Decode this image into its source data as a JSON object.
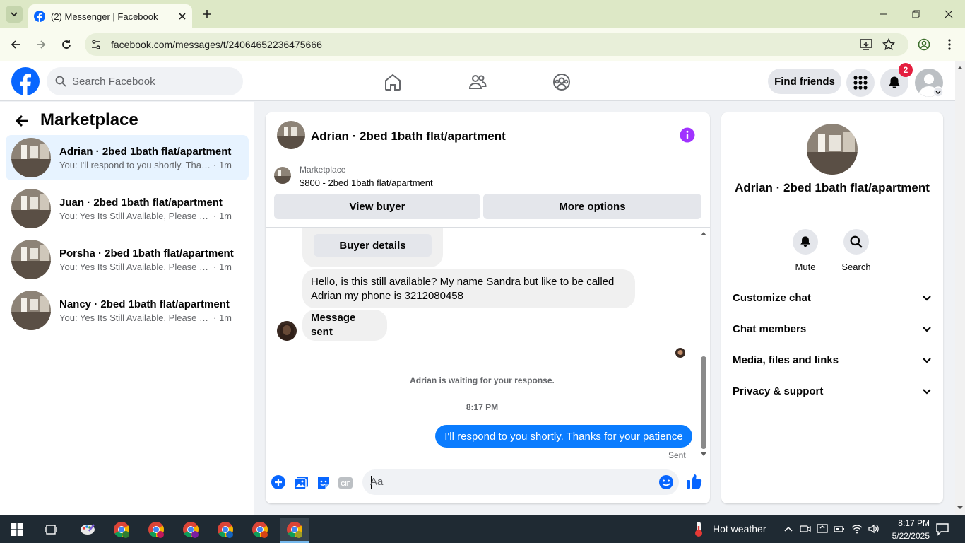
{
  "browser": {
    "tab_title": "(2) Messenger | Facebook",
    "url": "facebook.com/messages/t/24064652236475666"
  },
  "header": {
    "search_placeholder": "Search Facebook",
    "find_friends_label": "Find friends",
    "notification_count": "2"
  },
  "left_panel": {
    "title": "Marketplace",
    "conversations": [
      {
        "name": "Adrian · 2bed 1bath flat/apartment",
        "preview": "You: I'll respond to you shortly. Than...",
        "time": "· 1m",
        "active": true
      },
      {
        "name": "Juan · 2bed 1bath flat/apartment",
        "preview": "You: Yes Its Still Available, Please Sen...",
        "time": "· 1m",
        "active": false
      },
      {
        "name": "Porsha · 2bed 1bath flat/apartment",
        "preview": "You: Yes Its Still Available, Please Sen...",
        "time": "· 1m",
        "active": false
      },
      {
        "name": "Nancy · 2bed 1bath flat/apartment",
        "preview": "You: Yes Its Still Available, Please Sen...",
        "time": "· 1m",
        "active": false
      }
    ]
  },
  "chat": {
    "title": "Adrian · 2bed 1bath flat/apartment",
    "marketplace_label": "Marketplace",
    "listing": "$800 - 2bed 1bath flat/apartment",
    "view_buyer_label": "View buyer",
    "more_options_label": "More options",
    "buyer_details_label": "Buyer details",
    "incoming_message": "Hello, is this still available? My name Sandra but like to be called Adrian my phone is 3212080458",
    "message_sent": "Message sent",
    "system_message": "Adrian is waiting for your response.",
    "timestamp": "8:17 PM",
    "outgoing_message": "I'll respond to you shortly. Thanks for your patience",
    "sent_label": "Sent",
    "composer_placeholder": "Aa"
  },
  "right_panel": {
    "name": "Adrian · 2bed 1bath flat/apartment",
    "mute_label": "Mute",
    "search_label": "Search",
    "sections": [
      "Customize chat",
      "Chat members",
      "Media, files and links",
      "Privacy & support"
    ]
  },
  "taskbar": {
    "weather": "Hot weather",
    "time": "8:17 PM",
    "date": "5/22/2025"
  },
  "colors": {
    "facebook_blue": "#0866ff",
    "messenger_blue": "#0a7cff",
    "active_conv_bg": "#e7f3ff",
    "info_purple": "#a033ff",
    "badge_red": "#e41e3f"
  }
}
